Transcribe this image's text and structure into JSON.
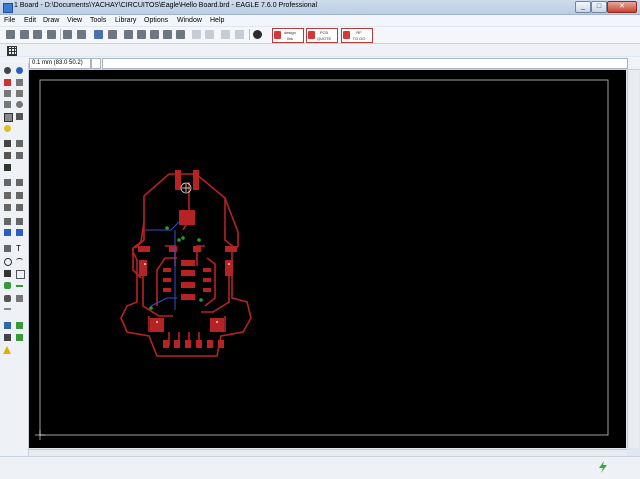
{
  "window": {
    "title": "1 Board - D:\\Documents\\YACHAY\\CIRCUITOS\\Eagle\\Hello Board.brd - EAGLE 7.6.0 Professional"
  },
  "menu": [
    "File",
    "Edit",
    "Draw",
    "View",
    "Tools",
    "Library",
    "Options",
    "Window",
    "Help"
  ],
  "brand_buttons": [
    {
      "line1": "design",
      "line2": "link"
    },
    {
      "line1": "PCB",
      "line2": "QUOTE"
    },
    {
      "line1": "RF",
      "line2": "TO GO"
    }
  ],
  "coordinate_readout": "0.1 mm (83.0 50.2)",
  "command_input": "",
  "status_text": "",
  "colors": {
    "canvas_bg": "#000000",
    "top_copper": "#b52325",
    "bottom_copper": "#3152c9",
    "vias": "#2e9a2e",
    "frame": "#c8c8c8",
    "ratsnest_and_labels": "#ffffff"
  },
  "icons": [
    "new-icon",
    "open-icon",
    "save-icon",
    "print-icon",
    "cam-icon",
    "zoom-in-icon",
    "zoom-out-icon",
    "undo-icon",
    "redo-icon",
    "stop-icon",
    "help-icon",
    "go-icon"
  ]
}
